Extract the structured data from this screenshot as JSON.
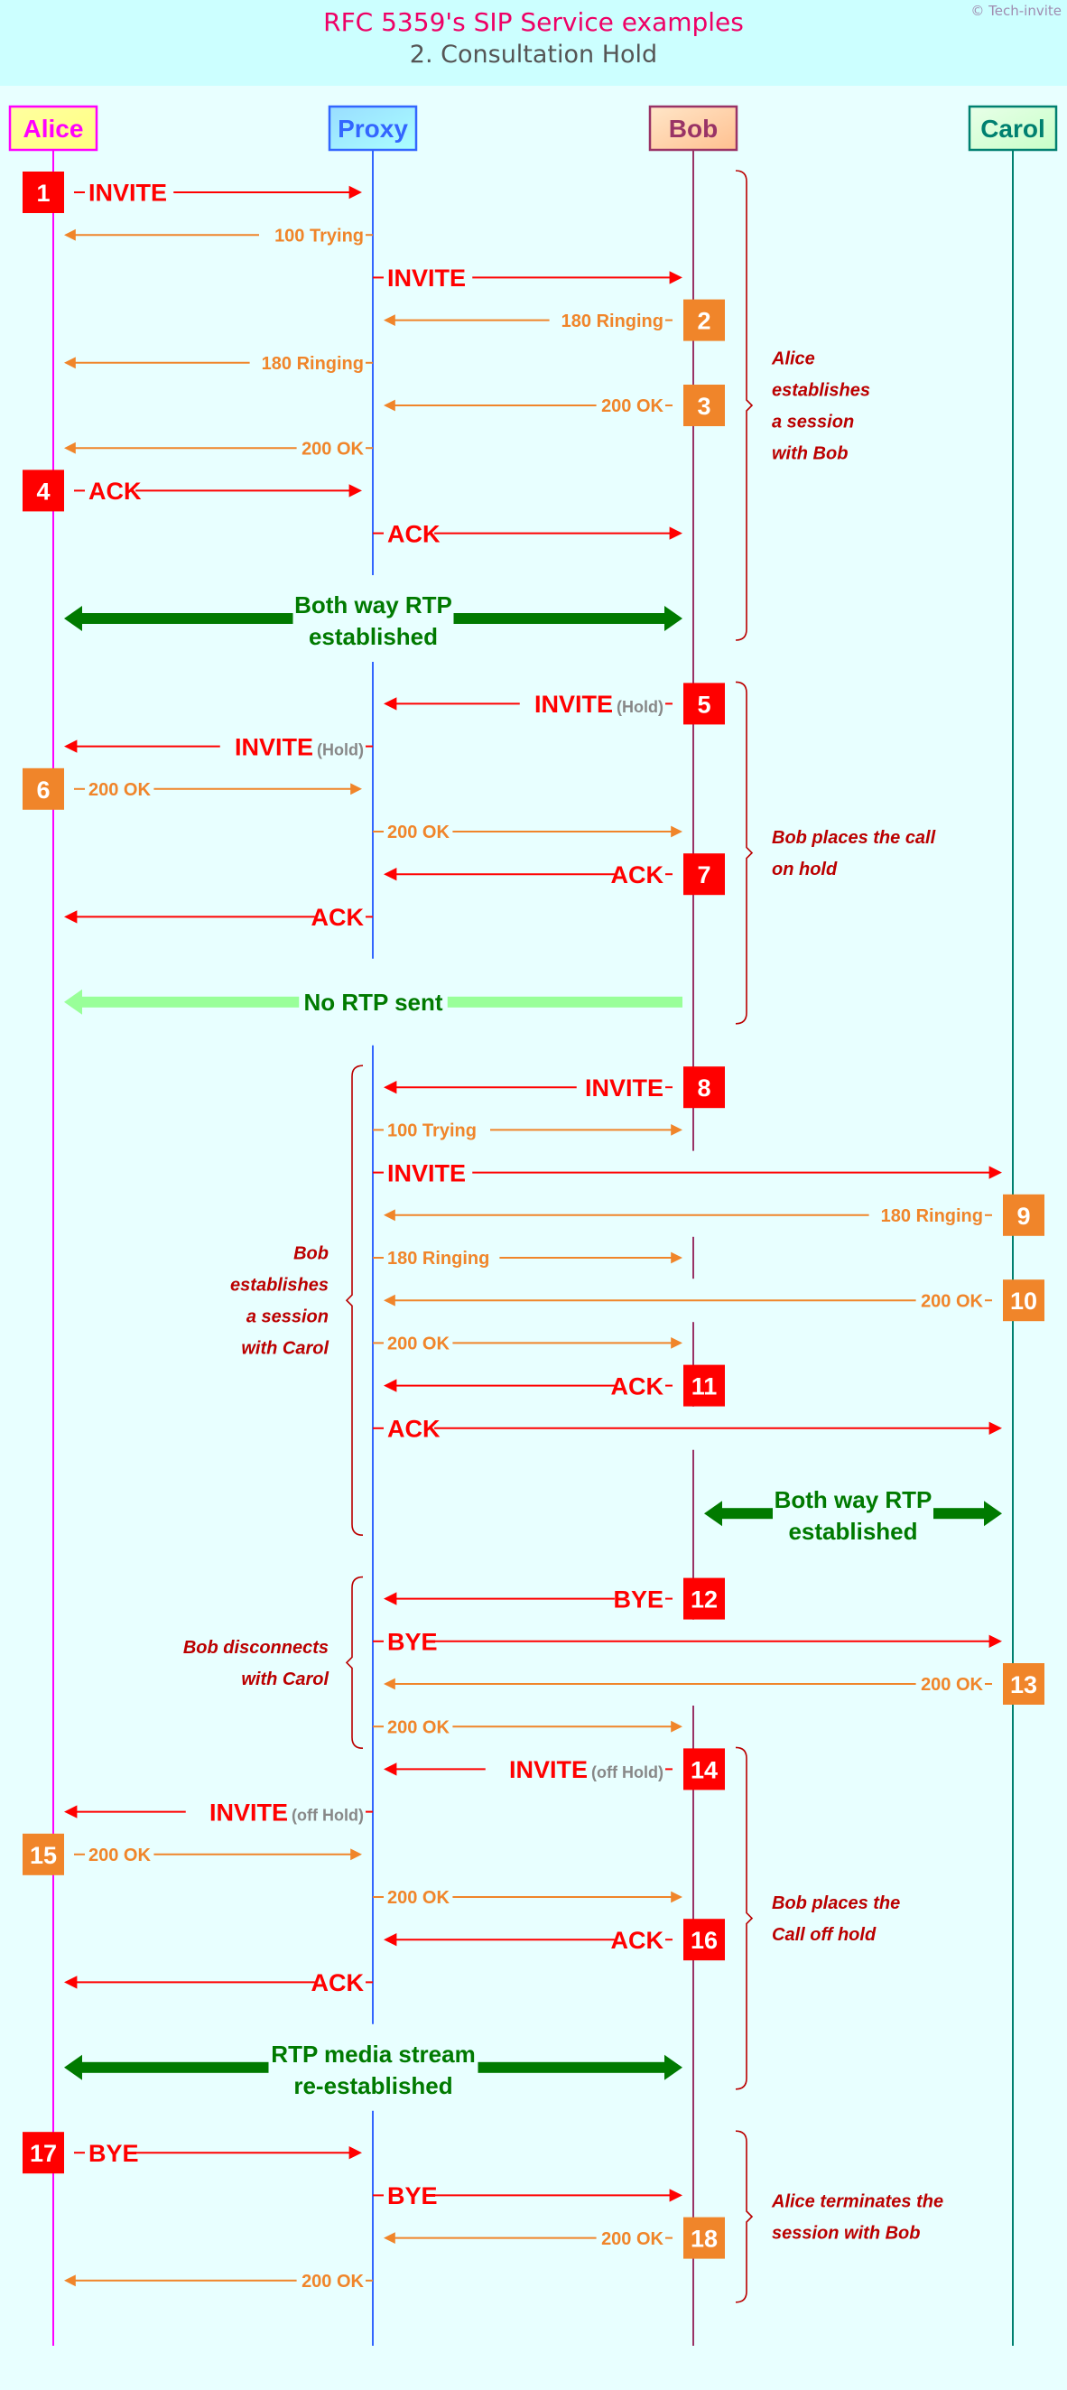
{
  "header": {
    "title": "RFC 5359's SIP Service examples",
    "subtitle": "2. Consultation Hold",
    "copyright": "© Tech-invite"
  },
  "colors": {
    "request": "#ff0000",
    "response": "#f0852a",
    "rtp": "#007a00",
    "rtp_paused": "#99ff99",
    "note": "#bb0000",
    "hold_tag": "#888888"
  },
  "actors": [
    {
      "id": "alice",
      "name": "Alice",
      "text_color": "#ff00ff",
      "border": "#ff00ff",
      "fill_top": "#ffffa0",
      "fill_bottom": "#ffff80"
    },
    {
      "id": "proxy",
      "name": "Proxy",
      "text_color": "#3366ff",
      "border": "#3366ff",
      "fill_top": "#99ddff",
      "fill_bottom": "#aaffff"
    },
    {
      "id": "bob",
      "name": "Bob",
      "text_color": "#993366",
      "border": "#993366",
      "fill_top": "#ffe6c8",
      "fill_bottom": "#ffc090"
    },
    {
      "id": "carol",
      "name": "Carol",
      "text_color": "#008070",
      "border": "#008070",
      "fill_top": "#e8ffe8",
      "fill_bottom": "#c8ffc8"
    }
  ],
  "messages": [
    {
      "step": "1",
      "from": "alice",
      "to": "proxy",
      "label": "INVITE",
      "kind": "request"
    },
    {
      "step": "",
      "from": "proxy",
      "to": "alice",
      "label": "100 Trying",
      "kind": "response"
    },
    {
      "step": "",
      "from": "proxy",
      "to": "bob",
      "label": "INVITE",
      "kind": "request"
    },
    {
      "step": "2",
      "from": "bob",
      "to": "proxy",
      "label": "180 Ringing",
      "kind": "response"
    },
    {
      "step": "",
      "from": "proxy",
      "to": "alice",
      "label": "180 Ringing",
      "kind": "response"
    },
    {
      "step": "3",
      "from": "bob",
      "to": "proxy",
      "label": "200 OK",
      "kind": "response"
    },
    {
      "step": "",
      "from": "proxy",
      "to": "alice",
      "label": "200 OK",
      "kind": "response"
    },
    {
      "step": "4",
      "from": "alice",
      "to": "proxy",
      "label": "ACK",
      "kind": "request"
    },
    {
      "step": "",
      "from": "proxy",
      "to": "bob",
      "label": "ACK",
      "kind": "request"
    },
    {
      "rtp": true,
      "from": "alice",
      "to": "bob",
      "label": [
        "Both way RTP",
        "established"
      ],
      "style": "both"
    },
    {
      "step": "5",
      "from": "bob",
      "to": "proxy",
      "label": "INVITE",
      "tag": "(Hold)",
      "kind": "request"
    },
    {
      "step": "",
      "from": "proxy",
      "to": "alice",
      "label": "INVITE",
      "tag": "(Hold)",
      "kind": "request"
    },
    {
      "step": "6",
      "from": "alice",
      "to": "proxy",
      "label": "200 OK",
      "kind": "response"
    },
    {
      "step": "",
      "from": "proxy",
      "to": "bob",
      "label": "200 OK",
      "kind": "response"
    },
    {
      "step": "7",
      "from": "bob",
      "to": "proxy",
      "label": "ACK",
      "kind": "request"
    },
    {
      "step": "",
      "from": "proxy",
      "to": "alice",
      "label": "ACK",
      "kind": "request"
    },
    {
      "rtp": true,
      "from": "alice",
      "to": "bob",
      "label": [
        "No RTP sent"
      ],
      "style": "none"
    },
    {
      "step": "8",
      "from": "bob",
      "to": "proxy",
      "label": "INVITE",
      "kind": "request"
    },
    {
      "step": "",
      "from": "proxy",
      "to": "bob",
      "label": "100 Trying",
      "kind": "response"
    },
    {
      "step": "",
      "from": "proxy",
      "to": "carol",
      "label": "INVITE",
      "kind": "request"
    },
    {
      "step": "9",
      "from": "carol",
      "to": "proxy",
      "label": "180 Ringing",
      "kind": "response"
    },
    {
      "step": "",
      "from": "proxy",
      "to": "bob",
      "label": "180 Ringing",
      "kind": "response"
    },
    {
      "step": "10",
      "from": "carol",
      "to": "proxy",
      "label": "200 OK",
      "kind": "response"
    },
    {
      "step": "",
      "from": "proxy",
      "to": "bob",
      "label": "200 OK",
      "kind": "response"
    },
    {
      "step": "11",
      "from": "bob",
      "to": "proxy",
      "label": "ACK",
      "kind": "request"
    },
    {
      "step": "",
      "from": "proxy",
      "to": "carol",
      "label": "ACK",
      "kind": "request"
    },
    {
      "rtp": true,
      "from": "bob",
      "to": "carol",
      "label": [
        "Both way RTP",
        "established"
      ],
      "style": "both"
    },
    {
      "step": "12",
      "from": "bob",
      "to": "proxy",
      "label": "BYE",
      "kind": "request"
    },
    {
      "step": "",
      "from": "proxy",
      "to": "carol",
      "label": "BYE",
      "kind": "request"
    },
    {
      "step": "13",
      "from": "carol",
      "to": "proxy",
      "label": "200 OK",
      "kind": "response"
    },
    {
      "step": "",
      "from": "proxy",
      "to": "bob",
      "label": "200 OK",
      "kind": "response"
    },
    {
      "step": "14",
      "from": "bob",
      "to": "proxy",
      "label": "INVITE",
      "tag": "(off Hold)",
      "kind": "request"
    },
    {
      "step": "",
      "from": "proxy",
      "to": "alice",
      "label": "INVITE",
      "tag": "(off Hold)",
      "kind": "request"
    },
    {
      "step": "15",
      "from": "alice",
      "to": "proxy",
      "label": "200 OK",
      "kind": "response"
    },
    {
      "step": "",
      "from": "proxy",
      "to": "bob",
      "label": "200 OK",
      "kind": "response"
    },
    {
      "step": "16",
      "from": "bob",
      "to": "proxy",
      "label": "ACK",
      "kind": "request"
    },
    {
      "step": "",
      "from": "proxy",
      "to": "alice",
      "label": "ACK",
      "kind": "request"
    },
    {
      "rtp": true,
      "from": "alice",
      "to": "bob",
      "label": [
        "RTP media stream",
        "re-established"
      ],
      "style": "both"
    },
    {
      "step": "17",
      "from": "alice",
      "to": "proxy",
      "label": "BYE",
      "kind": "request"
    },
    {
      "step": "",
      "from": "proxy",
      "to": "bob",
      "label": "BYE",
      "kind": "request"
    },
    {
      "step": "18",
      "from": "bob",
      "to": "proxy",
      "label": "200 OK",
      "kind": "response"
    },
    {
      "step": "",
      "from": "proxy",
      "to": "alice",
      "label": "200 OK",
      "kind": "response"
    }
  ],
  "phases": [
    {
      "side": "right",
      "first": 0,
      "last": 9,
      "lines": [
        "Alice",
        "establishes",
        "a session",
        "with Bob"
      ]
    },
    {
      "side": "right",
      "first": 10,
      "last": 16,
      "lines": [
        "Bob places the call",
        "on hold"
      ]
    },
    {
      "side": "left",
      "first": 17,
      "last": 26,
      "lines": [
        "Bob",
        "establishes",
        "a session",
        "with Carol"
      ]
    },
    {
      "side": "left",
      "first": 27,
      "last": 30,
      "lines": [
        "Bob disconnects",
        "with Carol"
      ]
    },
    {
      "side": "right",
      "first": 31,
      "last": 37,
      "lines": [
        "Bob places the",
        "Call off hold"
      ]
    },
    {
      "side": "right",
      "first": 38,
      "last": 41,
      "lines": [
        "Alice terminates the",
        "session with Bob"
      ]
    }
  ]
}
